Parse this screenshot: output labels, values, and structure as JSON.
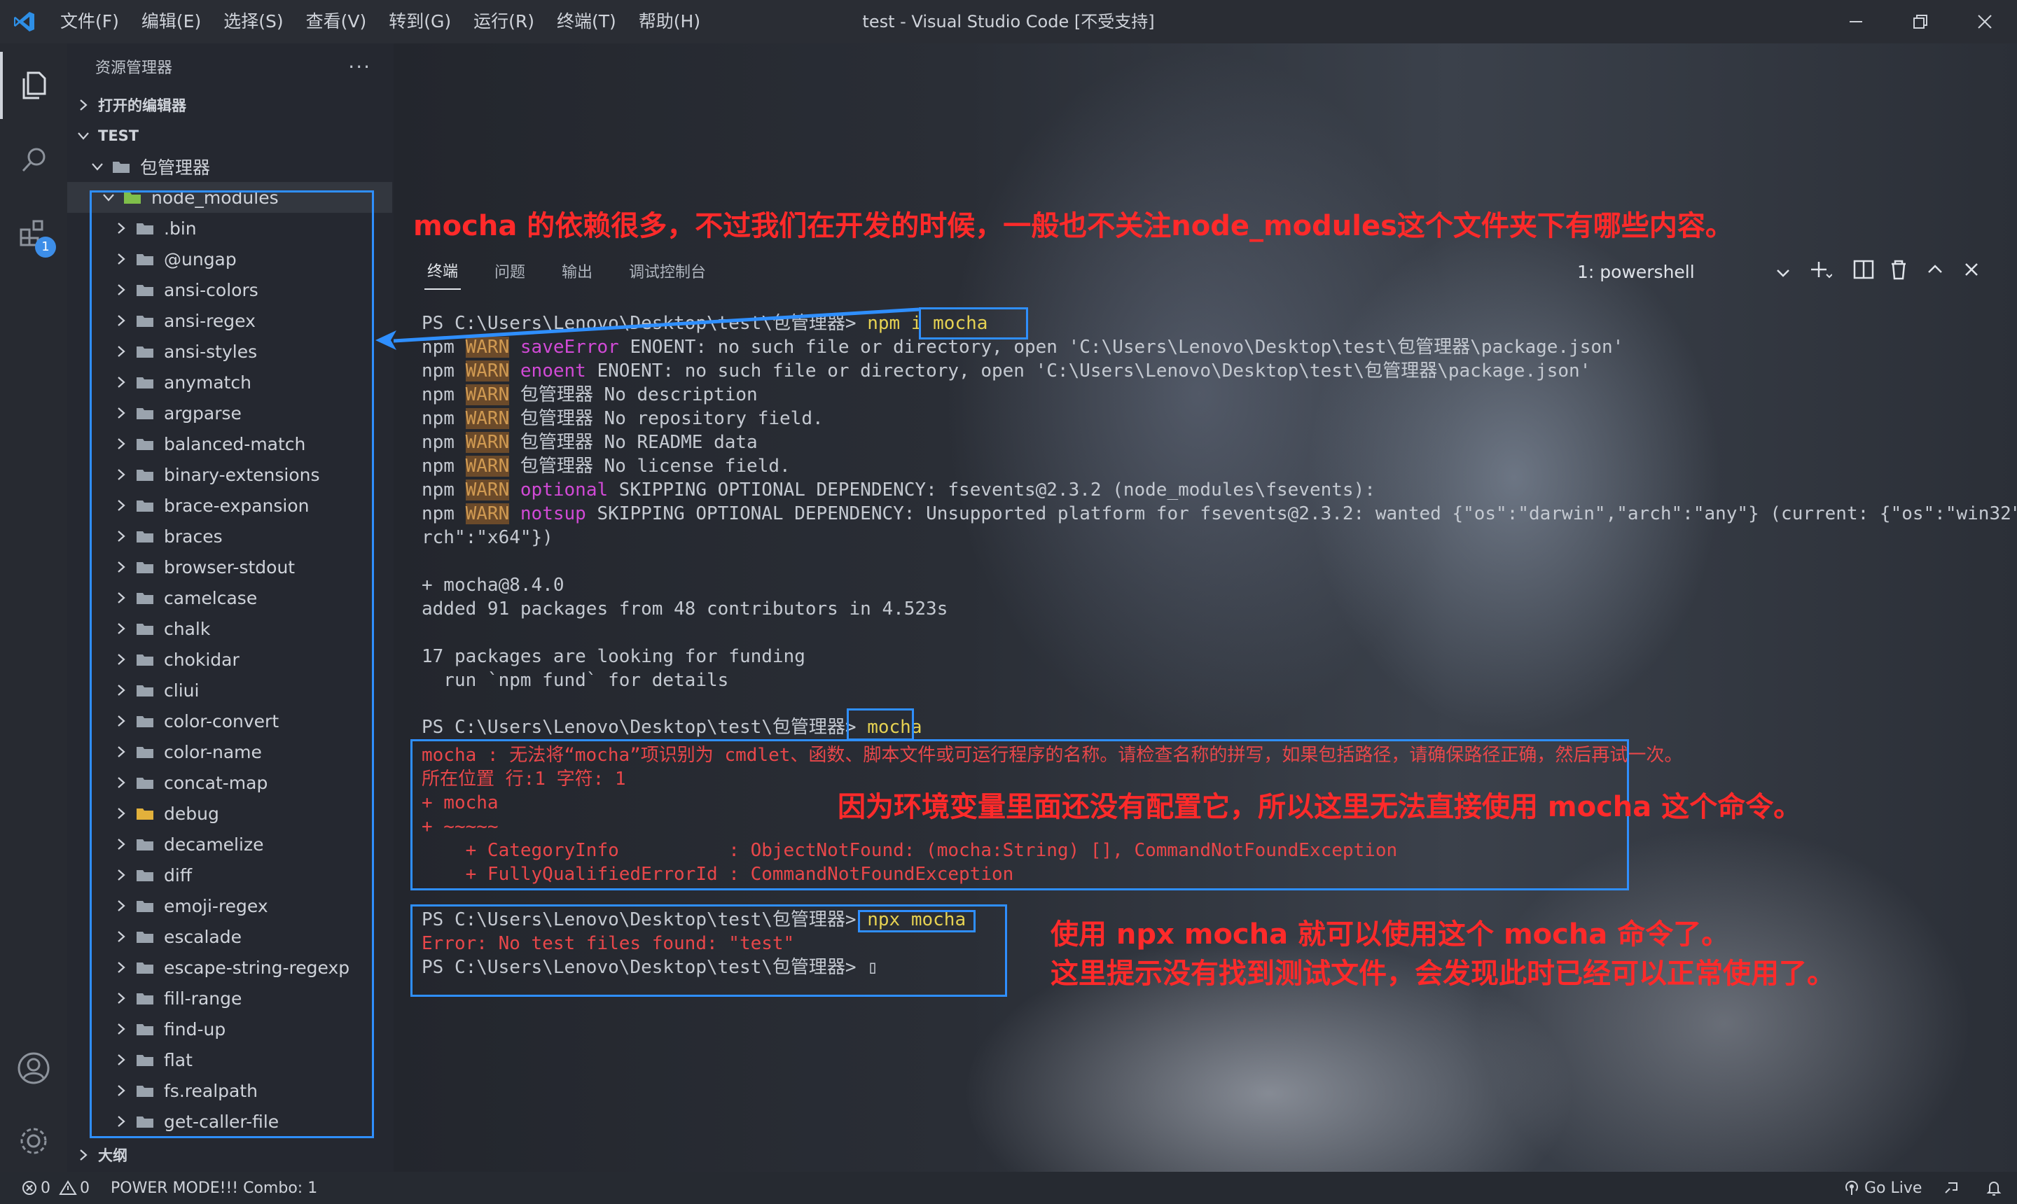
{
  "titlebar": {
    "menus": [
      "文件(F)",
      "编辑(E)",
      "选择(S)",
      "查看(V)",
      "转到(G)",
      "运行(R)",
      "终端(T)",
      "帮助(H)"
    ],
    "window_title": "test - Visual Studio Code [不受支持]"
  },
  "activitybar": {
    "extensions_badge": "1"
  },
  "sidebar": {
    "title": "资源管理器",
    "more": "···",
    "open_editors": "打开的编辑器",
    "workspace": "TEST",
    "root_folder": "包管理器",
    "node_modules": "node_modules",
    "folders": [
      ".bin",
      "@ungap",
      "ansi-colors",
      "ansi-regex",
      "ansi-styles",
      "anymatch",
      "argparse",
      "balanced-match",
      "binary-extensions",
      "brace-expansion",
      "braces",
      "browser-stdout",
      "camelcase",
      "chalk",
      "chokidar",
      "cliui",
      "color-convert",
      "color-name",
      "concat-map",
      "debug",
      "decamelize",
      "diff",
      "emoji-regex",
      "escalade",
      "escape-string-regexp",
      "fill-range",
      "find-up",
      "flat",
      "fs.realpath",
      "get-caller-file"
    ],
    "outline": "大纲"
  },
  "annotations": {
    "top": "mocha 的依赖很多，不过我们在开发的时候，一般也不关注node_modules这个文件夹下有哪些内容。",
    "middle": "因为环境变量里面还没有配置它，所以这里无法直接使用 mocha 这个命令。",
    "bottom_1": "使用 npx mocha 就可以使用这个 mocha 命令了。",
    "bottom_2": "这里提示没有找到测试文件，会发现此时已经可以正常使用了。"
  },
  "panel": {
    "tabs": [
      "终端",
      "问题",
      "输出",
      "调试控制台"
    ],
    "terminal_select": "1: powershell"
  },
  "terminal": {
    "prompt": "PS C:\\Users\\Lenovo\\Desktop\\test\\包管理器>",
    "cmd1_prefix": " npm i ",
    "cmd1_arg": "mocha",
    "npm": "npm",
    "warn": "WARN",
    "warn_lines": [
      {
        "tag": "saveError",
        "text": " ENOENT: no such file or directory, open 'C:\\Users\\Lenovo\\Desktop\\test\\包管理器\\package.json'"
      },
      {
        "tag": "enoent",
        "text": " ENOENT: no such file or directory, open 'C:\\Users\\Lenovo\\Desktop\\test\\包管理器\\package.json'"
      },
      {
        "tag": "",
        "text": "包管理器 No description"
      },
      {
        "tag": "",
        "text": "包管理器 No repository field."
      },
      {
        "tag": "",
        "text": "包管理器 No README data"
      },
      {
        "tag": "",
        "text": "包管理器 No license field."
      },
      {
        "tag": "optional",
        "text": " SKIPPING OPTIONAL DEPENDENCY: fsevents@2.3.2 (node_modules\\fsevents):"
      },
      {
        "tag": "notsup",
        "text": " SKIPPING OPTIONAL DEPENDENCY: Unsupported platform for fsevents@2.3.2: wanted {\"os\":\"darwin\",\"arch\":\"any\"} (current: {\"os\":\"win32\",\"a"
      }
    ],
    "wrap_line": "rch\":\"x64\"})",
    "added_1": "+ mocha@8.4.0",
    "added_2": "added 91 packages from 48 contributors in 4.523s",
    "funding_1": "17 packages are looking for funding",
    "funding_2": "  run `npm fund` for details",
    "cmd2": " mocha",
    "error_lines": [
      "mocha : 无法将“mocha”项识别为 cmdlet、函数、脚本文件或可运行程序的名称。请检查名称的拼写，如果包括路径，请确保路径正确，然后再试一次。",
      "所在位置 行:1 字符: 1",
      "+ mocha",
      "+ ~~~~~",
      "    + CategoryInfo          : ObjectNotFound: (mocha:String) [], CommandNotFoundException",
      "    + FullyQualifiedErrorId : CommandNotFoundException"
    ],
    "cmd3": "npx mocha",
    "error_nofiles": "Error: No test files found: \"test\"",
    "cursor": "▯"
  },
  "statusbar": {
    "errors": "0",
    "warnings": "0",
    "power_mode": "POWER MODE!!! Combo: 1",
    "go_live": "Go Live"
  },
  "colors": {
    "accent": "#2f8fff",
    "annotation": "#ff2a2a",
    "warn": "#d09a52",
    "magenta": "#d14ad6",
    "error": "#e8474a"
  }
}
